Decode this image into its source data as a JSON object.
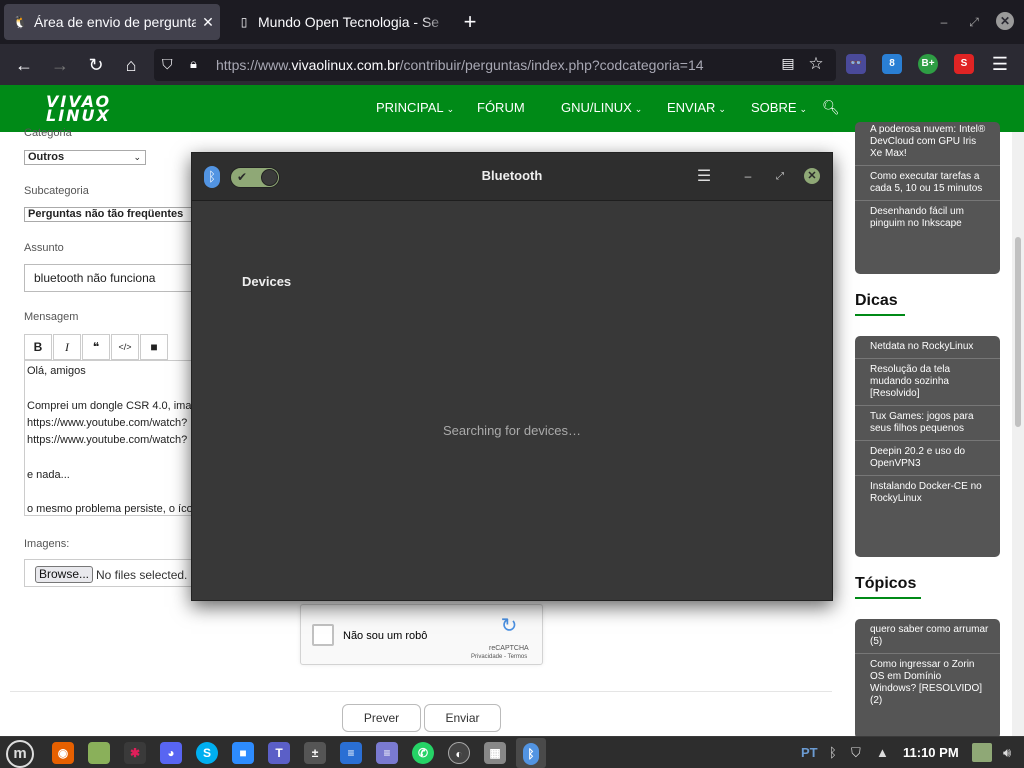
{
  "browser": {
    "tabs": [
      {
        "label": "Área de envio de perguntas",
        "favicon": "tux-icon",
        "active": true
      },
      {
        "label": "Mundo Open Tecnologia - Se",
        "favicon": "phone-icon",
        "active": false
      }
    ],
    "url_prefix": "https://www.",
    "url_domain": "vivaolinux.com.br",
    "url_path": "/contribuir/perguntas/index.php?codcategoria=14",
    "extensions": [
      {
        "name": "glasses-extension-icon",
        "label": "👓",
        "color": "#3a3a8a"
      },
      {
        "name": "badge-extension-icon",
        "label": "8",
        "color": "#2a7fd4"
      },
      {
        "name": "bplus-extension-icon",
        "label": "B+",
        "color": "#2e9e44"
      },
      {
        "name": "s-extension-icon",
        "label": "S",
        "color": "#e02424"
      }
    ]
  },
  "site": {
    "logo_line1": "VIVAO",
    "logo_line2": "LINUX",
    "menu": [
      {
        "label": "PRINCIPAL",
        "dropdown": true
      },
      {
        "label": "FÓRUM",
        "dropdown": false
      },
      {
        "label": "GNU/LINUX",
        "dropdown": true
      },
      {
        "label": "ENVIAR",
        "dropdown": true
      },
      {
        "label": "SOBRE",
        "dropdown": true
      }
    ],
    "header_color": "#008a17"
  },
  "form": {
    "categoria_label": "Categoria",
    "categoria_value": "Outros",
    "subcategoria_label": "Subcategoria",
    "subcategoria_value": "Perguntas não tão freqüentes",
    "assunto_label": "Assunto",
    "assunto_value": "bluetooth não funciona",
    "mensagem_label": "Mensagem",
    "toolbar": {
      "bold": "B",
      "italic": "I",
      "quote": "❝",
      "code": "</>",
      "video": "■"
    },
    "message_lines": [
      "Olá, amigos",
      "",
      "Comprei um dongle CSR 4.0, ima",
      "https://www.youtube.com/watch?",
      "https://www.youtube.com/watch?",
      "",
      "e nada...",
      "",
      "o mesmo problema persiste, o íco"
    ],
    "imagens_label": "Imagens:",
    "browse_label": "Browse...",
    "no_file_text": "No files selected.",
    "captcha_text": "Não sou um robô",
    "captcha_brand": "reCAPTCHA",
    "captcha_terms": "Privacidade - Termos",
    "preview_label": "Prever",
    "submit_label": "Enviar"
  },
  "sidebar": {
    "top_items": [
      "A poderosa nuvem: Intel® DevCloud com GPU Iris Xe Max!",
      "Como executar tarefas a cada 5, 10 ou 15 minutos",
      "Desenhando fácil um pinguim no Inkscape"
    ],
    "dicas_heading": "Dicas",
    "dicas": [
      "Netdata no RockyLinux",
      "Resolução da tela mudando sozinha [Resolvido]",
      "Tux Games: jogos para seus filhos pequenos",
      "Deepin 20.2 e uso do OpenVPN3",
      "Instalando Docker-CE no RockyLinux"
    ],
    "topicos_heading": "Tópicos",
    "topicos": [
      "quero saber como arrumar (5)",
      "Como ingressar o Zorin OS em Domínio Windows? [RESOLVIDO] (2)"
    ]
  },
  "bluetooth": {
    "title": "Bluetooth",
    "enabled": true,
    "devices_heading": "Devices",
    "status_text": "Searching for devices…",
    "accent": "#8fa876"
  },
  "taskbar": {
    "apps": [
      {
        "name": "mint-menu-icon",
        "label": "m",
        "color": "#6a6a6a"
      },
      {
        "name": "firefox-icon",
        "label": "◉",
        "color": "#e66000"
      },
      {
        "name": "files-icon",
        "label": "",
        "color": "#8ab05a"
      },
      {
        "name": "slack-icon",
        "label": "✱",
        "color": "#3a3a3a"
      },
      {
        "name": "discord-icon",
        "label": "◕",
        "color": "#5865f2"
      },
      {
        "name": "skype-icon",
        "label": "S",
        "color": "#00aff0"
      },
      {
        "name": "zoom-icon",
        "label": "■",
        "color": "#2d8cff"
      },
      {
        "name": "teams-icon",
        "label": "T",
        "color": "#5b5fc7"
      },
      {
        "name": "calculator-icon",
        "label": "±",
        "color": "#555"
      },
      {
        "name": "writer-icon",
        "label": "≡",
        "color": "#2a6fd4"
      },
      {
        "name": "text-editor-icon",
        "label": "≡",
        "color": "#7a7ad0"
      },
      {
        "name": "whatsapp-icon",
        "label": "✆",
        "color": "#25d366"
      },
      {
        "name": "network-icon",
        "label": "◐",
        "color": "#444"
      },
      {
        "name": "app-grid-icon",
        "label": "▦",
        "color": "#888"
      },
      {
        "name": "bluetooth-task-icon",
        "label": "ᛒ",
        "color": "#5294e2"
      }
    ],
    "keyboard_layout": "PT",
    "clock": "11:10 PM"
  }
}
